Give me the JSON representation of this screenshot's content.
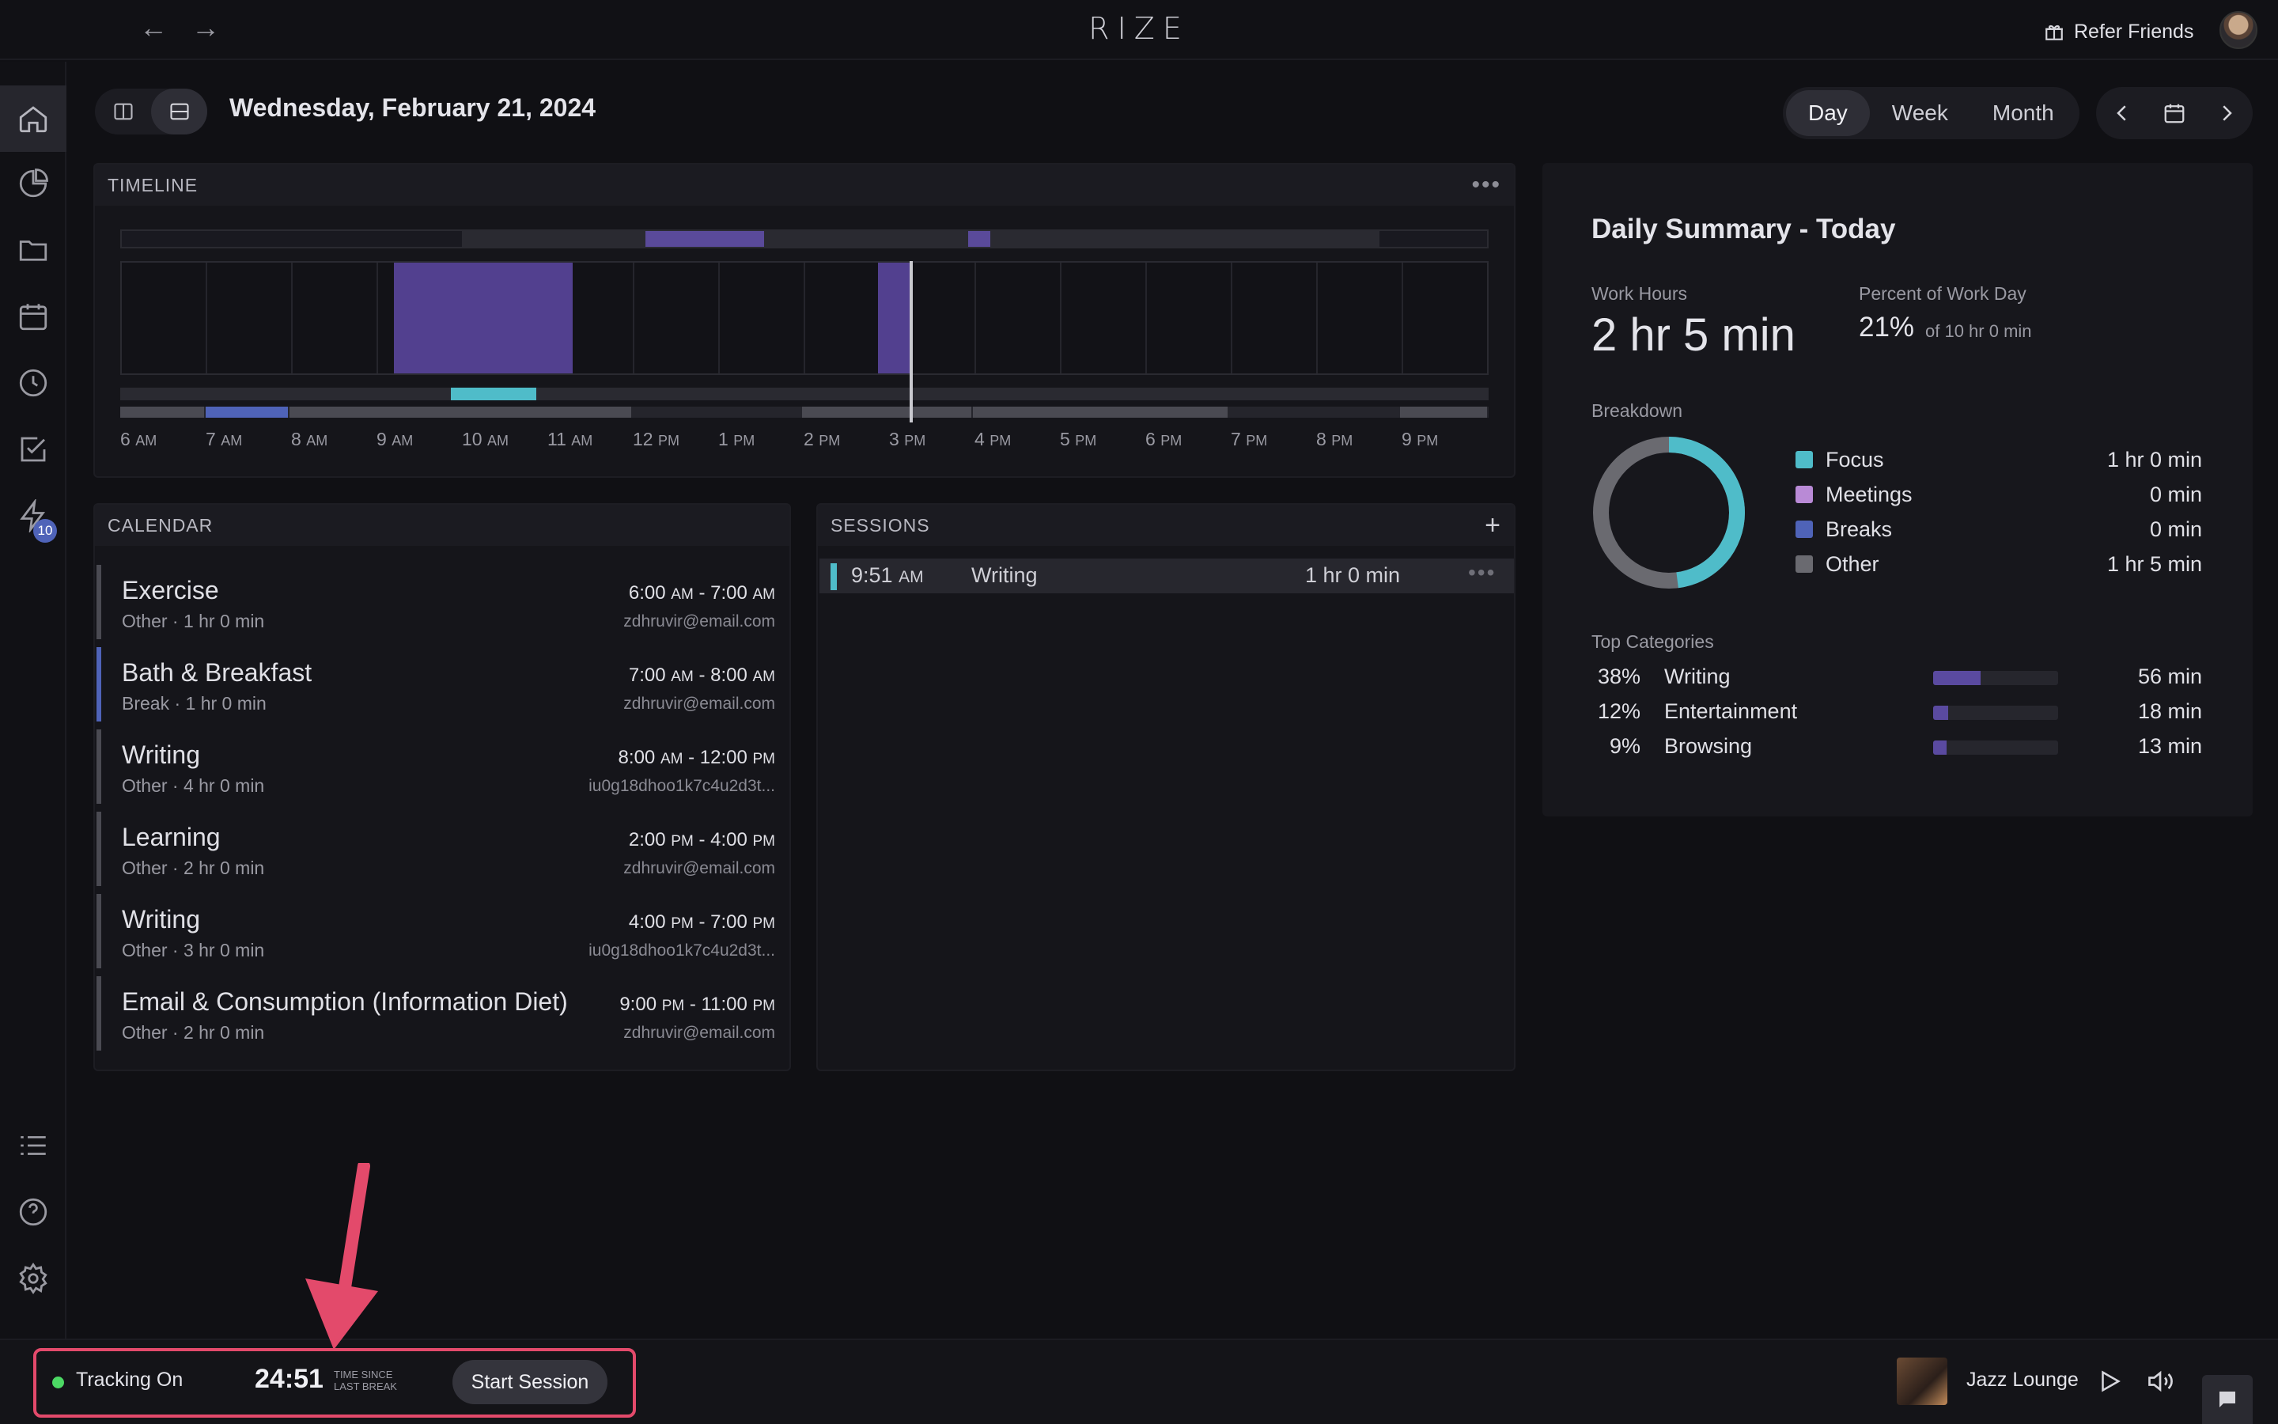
{
  "app": {
    "logo": "RIZE"
  },
  "topbar": {
    "back": "←",
    "forward": "→",
    "refer_label": "Refer Friends"
  },
  "sidebar": {
    "badge_count": "10",
    "active_item": "home"
  },
  "header": {
    "date_title": "Wednesday, February 21, 2024",
    "tabs": [
      {
        "label": "Day",
        "active": true
      },
      {
        "label": "Week"
      },
      {
        "label": "Month"
      }
    ]
  },
  "timeline": {
    "title": "TIMELINE",
    "hours": [
      {
        "num": "6",
        "ampm": "AM"
      },
      {
        "num": "7",
        "ampm": "AM"
      },
      {
        "num": "8",
        "ampm": "AM"
      },
      {
        "num": "9",
        "ampm": "AM"
      },
      {
        "num": "10",
        "ampm": "AM"
      },
      {
        "num": "11",
        "ampm": "AM"
      },
      {
        "num": "12",
        "ampm": "PM"
      },
      {
        "num": "1",
        "ampm": "PM"
      },
      {
        "num": "2",
        "ampm": "PM"
      },
      {
        "num": "3",
        "ampm": "PM"
      },
      {
        "num": "4",
        "ampm": "PM"
      },
      {
        "num": "5",
        "ampm": "PM"
      },
      {
        "num": "6",
        "ampm": "PM"
      },
      {
        "num": "7",
        "ampm": "PM"
      },
      {
        "num": "8",
        "ampm": "PM"
      },
      {
        "num": "9",
        "ampm": "PM"
      }
    ]
  },
  "calendar": {
    "title": "CALENDAR",
    "events": [
      {
        "title": "Exercise",
        "sub": "Other · 1 hr 0 min",
        "time_start": "6:00",
        "ap1": "AM",
        "time_end": "7:00",
        "ap2": "AM",
        "account": "zdhruvir@email.com",
        "color": "#4a4a52"
      },
      {
        "title": "Bath & Breakfast",
        "sub": "Break · 1 hr 0 min",
        "time_start": "7:00",
        "ap1": "AM",
        "time_end": "8:00",
        "ap2": "AM",
        "account": "zdhruvir@email.com",
        "color": "#4f63b8"
      },
      {
        "title": "Writing",
        "sub": "Other · 4 hr 0 min",
        "time_start": "8:00",
        "ap1": "AM",
        "time_end": "12:00",
        "ap2": "PM",
        "account": "iu0g18dhoo1k7c4u2d3t...",
        "color": "#4a4a52"
      },
      {
        "title": "Learning",
        "sub": "Other · 2 hr 0 min",
        "time_start": "2:00",
        "ap1": "PM",
        "time_end": "4:00",
        "ap2": "PM",
        "account": "zdhruvir@email.com",
        "color": "#4a4a52"
      },
      {
        "title": "Writing",
        "sub": "Other · 3 hr 0 min",
        "time_start": "4:00",
        "ap1": "PM",
        "time_end": "7:00",
        "ap2": "PM",
        "account": "iu0g18dhoo1k7c4u2d3t...",
        "color": "#4a4a52"
      },
      {
        "title": "Email & Consumption (Information Diet)",
        "sub": "Other · 2 hr 0 min",
        "time_start": "9:00",
        "ap1": "PM",
        "time_end": "11:00",
        "ap2": "PM",
        "account": "zdhruvir@email.com",
        "color": "#4a4a52"
      }
    ]
  },
  "sessions": {
    "title": "SESSIONS",
    "add": "+",
    "items": [
      {
        "time": "9:51",
        "ampm": "AM",
        "name": "Writing",
        "duration": "1 hr 0 min"
      }
    ]
  },
  "summary": {
    "title": "Daily Summary - Today",
    "work_hours_label": "Work Hours",
    "work_hours_value": "2 hr 5 min",
    "percent_label": "Percent of Work Day",
    "percent_value": "21%",
    "percent_of": "of 10 hr 0 min",
    "breakdown_label": "Breakdown",
    "donut_focus_fraction": 0.48,
    "breakdown": [
      {
        "name": "Focus",
        "value": "1 hr 0 min",
        "color": "#4fbcc9"
      },
      {
        "name": "Meetings",
        "value": "0 min",
        "color": "#b98ad6"
      },
      {
        "name": "Breaks",
        "value": "0 min",
        "color": "#4f63b8"
      },
      {
        "name": "Other",
        "value": "1 hr 5 min",
        "color": "#6a6a70"
      }
    ],
    "top_categories_label": "Top Categories",
    "categories": [
      {
        "pct": "38%",
        "name": "Writing",
        "value": "56 min",
        "fill": 0.38
      },
      {
        "pct": "12%",
        "name": "Entertainment",
        "value": "18 min",
        "fill": 0.12
      },
      {
        "pct": "9%",
        "name": "Browsing",
        "value": "13 min",
        "fill": 0.09
      }
    ]
  },
  "bottombar": {
    "tracking_label": "Tracking On",
    "timer": "24:51",
    "timer_caption_1": "TIME SINCE",
    "timer_caption_2": "LAST BREAK",
    "start_session": "Start Session",
    "music_title": "Jazz Lounge"
  }
}
